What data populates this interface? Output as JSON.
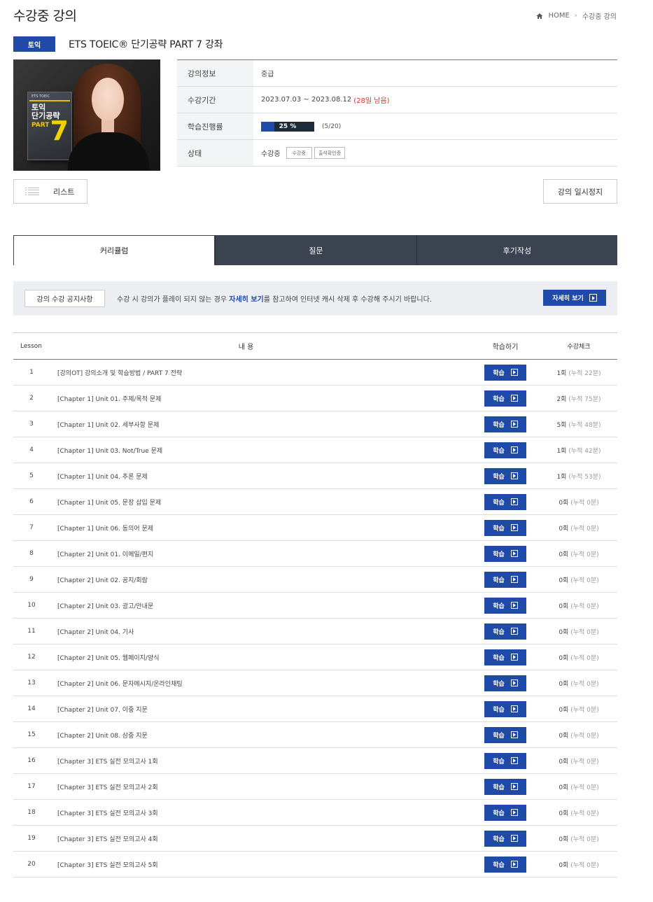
{
  "page": {
    "title": "수강중 강의"
  },
  "breadcrumb": {
    "home": "HOME",
    "current": "수강중 강의"
  },
  "course": {
    "category": "토익",
    "title": "ETS TOEIC® 단기공략 PART 7 강좌",
    "thumbnail": {
      "brand": "ETS TOEIC",
      "book_title_1": "토익",
      "book_title_2": "단기공략",
      "book_part": "PART",
      "book_number": "7"
    }
  },
  "info": {
    "level_label": "강의정보",
    "level_value": "중급",
    "period_label": "수강기간",
    "period_value": "2023.07.03 ~ 2023.08.12",
    "period_remain": "(28일 남음)",
    "progress_label": "학습진행률",
    "progress_percent": 25,
    "progress_text": "25 %",
    "progress_count": "(5/20)",
    "status_label": "상태",
    "status_value": "수강중",
    "status_chip_1": "수강중",
    "status_chip_2": "출석확인증"
  },
  "actions": {
    "list_label": "리스트",
    "pause_label": "강의 일시정지"
  },
  "tabs": [
    {
      "label": "커리큘럼",
      "active": true
    },
    {
      "label": "질문",
      "active": false
    },
    {
      "label": "후기작성",
      "active": false
    }
  ],
  "notice": {
    "label": "강의 수강 공지사항",
    "text_before": "수강 시 강의가 플레이 되지 않는 경우 ",
    "text_highlight": "자세히 보기",
    "text_after": "를 참고하여 인터넷 캐시 삭제 후 수강해 주시기 바랍니다.",
    "button": "자세히 보기"
  },
  "lesson_table": {
    "headers": {
      "no": "Lesson",
      "title": "내 용",
      "study": "학습하기",
      "check": "수강체크"
    },
    "study_label": "학습",
    "rows": [
      {
        "no": "1",
        "title": "[강의OT] 강의소개 및 학습방법 / PART 7 전략",
        "count": "1회",
        "cum": "(누적 22분)"
      },
      {
        "no": "2",
        "title": "[Chapter 1] Unit 01. 주제/목적 문제",
        "count": "2회",
        "cum": "(누적 75분)"
      },
      {
        "no": "3",
        "title": "[Chapter 1] Unit 02. 세부사항 문제",
        "count": "5회",
        "cum": "(누적 48분)"
      },
      {
        "no": "4",
        "title": "[Chapter 1] Unit 03. Not/True 문제",
        "count": "1회",
        "cum": "(누적 42분)"
      },
      {
        "no": "5",
        "title": "[Chapter 1] Unit 04. 추론 문제",
        "count": "1회",
        "cum": "(누적 53분)"
      },
      {
        "no": "6",
        "title": "[Chapter 1] Unit 05. 문장 삽입 문제",
        "count": "0회",
        "cum": "(누적 0분)"
      },
      {
        "no": "7",
        "title": "[Chapter 1] Unit 06. 동의어 문제",
        "count": "0회",
        "cum": "(누적 0분)"
      },
      {
        "no": "8",
        "title": "[Chapter 2] Unit 01. 이메일/편지",
        "count": "0회",
        "cum": "(누적 0분)"
      },
      {
        "no": "9",
        "title": "[Chapter 2] Unit 02. 공지/회람",
        "count": "0회",
        "cum": "(누적 0분)"
      },
      {
        "no": "10",
        "title": "[Chapter 2] Unit 03. 광고/안내문",
        "count": "0회",
        "cum": "(누적 0분)"
      },
      {
        "no": "11",
        "title": "[Chapter 2] Unit 04. 기사",
        "count": "0회",
        "cum": "(누적 0분)"
      },
      {
        "no": "12",
        "title": "[Chapter 2] Unit 05. 웹페이지/양식",
        "count": "0회",
        "cum": "(누적 0분)"
      },
      {
        "no": "13",
        "title": "[Chapter 2] Unit 06. 문자메시지/온라인채팅",
        "count": "0회",
        "cum": "(누적 0분)"
      },
      {
        "no": "14",
        "title": "[Chapter 2] Unit 07. 이중 지문",
        "count": "0회",
        "cum": "(누적 0분)"
      },
      {
        "no": "15",
        "title": "[Chapter 2] Unit 08. 삼중 지문",
        "count": "0회",
        "cum": "(누적 0분)"
      },
      {
        "no": "16",
        "title": "[Chapter 3] ETS 실전 모의고사 1회",
        "count": "0회",
        "cum": "(누적 0분)"
      },
      {
        "no": "17",
        "title": "[Chapter 3] ETS 실전 모의고사 2회",
        "count": "0회",
        "cum": "(누적 0분)"
      },
      {
        "no": "18",
        "title": "[Chapter 3] ETS 실전 모의고사 3회",
        "count": "0회",
        "cum": "(누적 0분)"
      },
      {
        "no": "19",
        "title": "[Chapter 3] ETS 실전 모의고사 4회",
        "count": "0회",
        "cum": "(누적 0분)"
      },
      {
        "no": "20",
        "title": "[Chapter 3] ETS 실전 모의고사 5회",
        "count": "0회",
        "cum": "(누적 0분)"
      }
    ]
  },
  "colors": {
    "accent": "#1f4aa8",
    "tab_dark": "#3b4250",
    "remain": "#dd3333"
  },
  "icons": {
    "home": "home-icon",
    "list": "list-icon",
    "play": "play-icon"
  }
}
